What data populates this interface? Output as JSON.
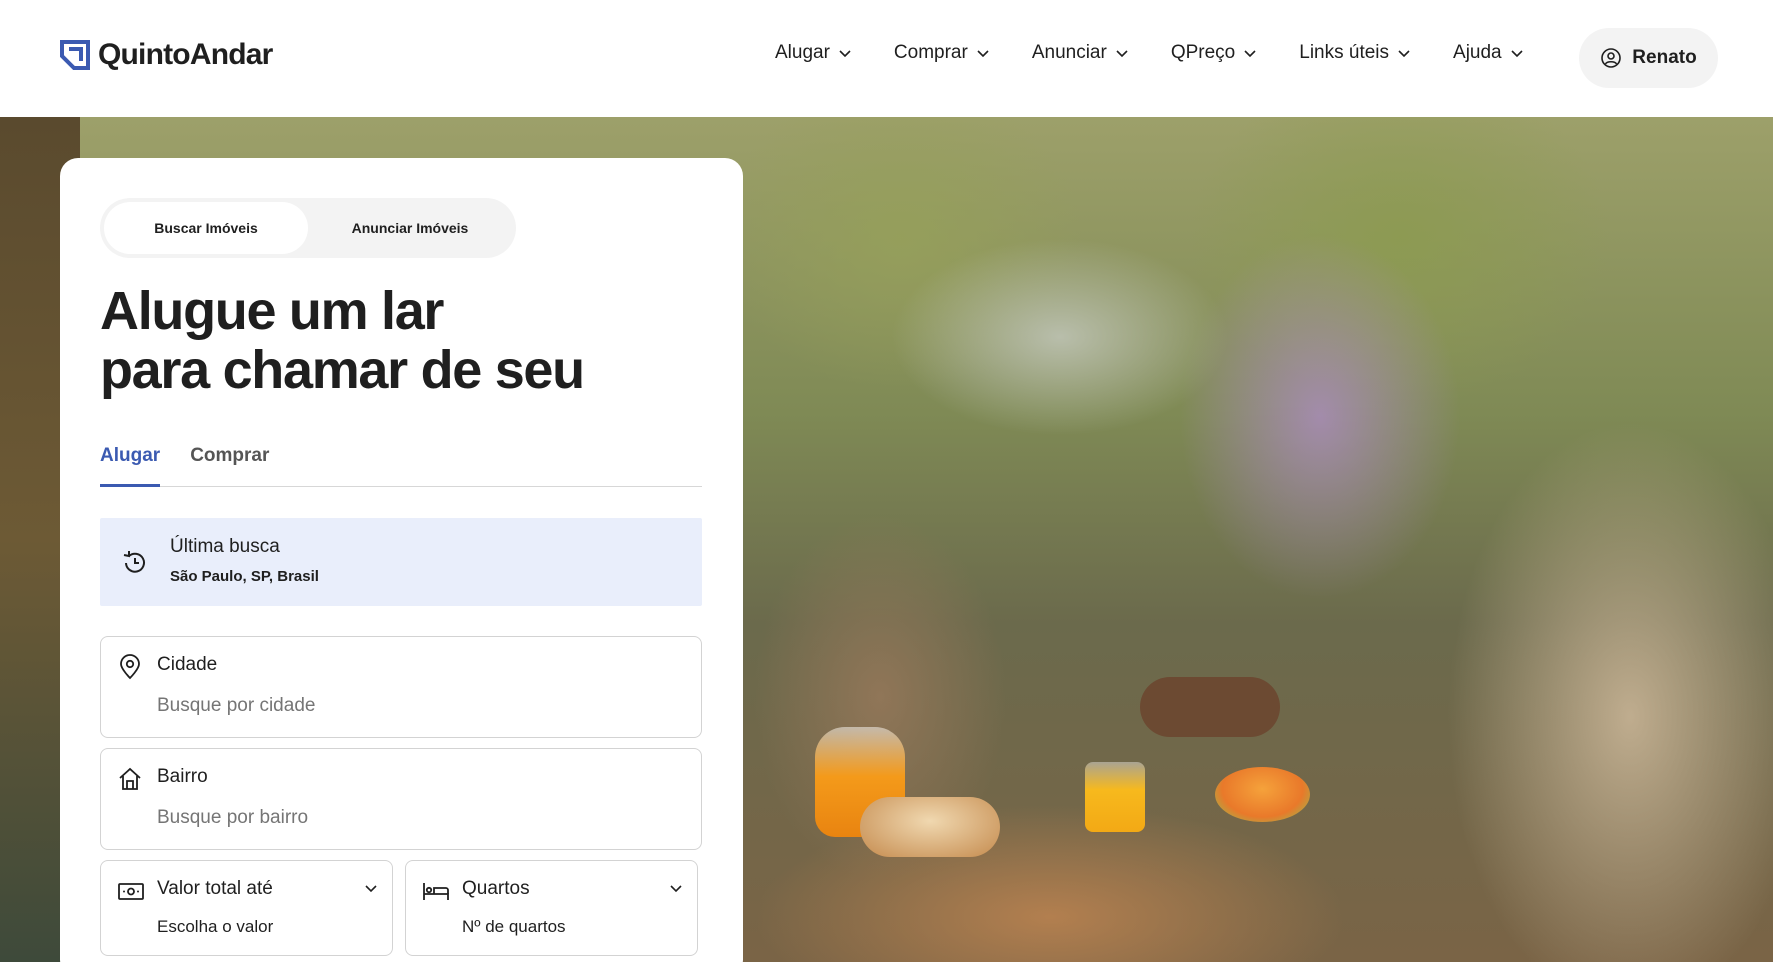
{
  "brand": {
    "name": "QuintoAndar",
    "accent": "#3b5ab1"
  },
  "nav": {
    "items": [
      {
        "label": "Alugar"
      },
      {
        "label": "Comprar"
      },
      {
        "label": "Anunciar"
      },
      {
        "label": "QPreço"
      },
      {
        "label": "Links úteis"
      },
      {
        "label": "Ajuda"
      }
    ],
    "user": {
      "name": "Renato",
      "icon": "user-circle-icon"
    }
  },
  "card": {
    "mode_toggle": {
      "search": "Buscar Imóveis",
      "announce": "Anunciar Imóveis"
    },
    "headline": {
      "line1": "Alugue um lar",
      "line2": "para chamar de seu"
    },
    "tabs": {
      "rent": "Alugar",
      "buy": "Comprar"
    },
    "last_search": {
      "title": "Última busca",
      "value": "São Paulo, SP, Brasil",
      "icon": "history-icon"
    },
    "city": {
      "label": "Cidade",
      "placeholder": "Busque por cidade",
      "icon": "location-pin-icon"
    },
    "neighborhood": {
      "label": "Bairro",
      "placeholder": "Busque por bairro",
      "icon": "house-icon"
    },
    "price": {
      "label": "Valor total até",
      "value": "Escolha o valor",
      "icon": "money-icon"
    },
    "rooms": {
      "label": "Quartos",
      "value": "Nº de quartos",
      "icon": "bed-icon"
    }
  }
}
